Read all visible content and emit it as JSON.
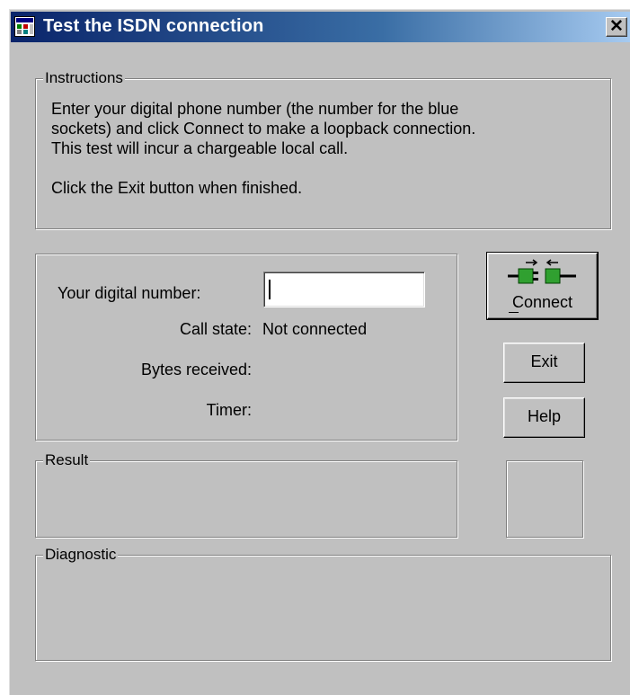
{
  "window": {
    "title": "Test the ISDN connection",
    "close_glyph": "✕"
  },
  "instructions": {
    "legend": "Instructions",
    "lines": [
      "Enter your digital phone number (the number for the blue",
      "sockets) and click Connect to make a loopback connection.",
      "This test will incur a chargeable local call.",
      "",
      "Click the Exit button when finished."
    ]
  },
  "form": {
    "number_label": "Your digital number:",
    "number_value": "",
    "call_state_label": "Call state:",
    "call_state_value": "Not connected",
    "bytes_label": "Bytes received:",
    "bytes_value": "",
    "timer_label": "Timer:",
    "timer_value": ""
  },
  "buttons": {
    "connect": "Connect",
    "connect_mnemonic": "C",
    "connect_icon": "plug-connect-icon",
    "exit": "Exit",
    "help": "Help"
  },
  "result": {
    "legend": "Result"
  },
  "diagnostic": {
    "legend": "Diagnostic"
  },
  "colors": {
    "titlebar_start": "#0a246a",
    "titlebar_end": "#a6caf0",
    "face": "#c0c0c0"
  }
}
